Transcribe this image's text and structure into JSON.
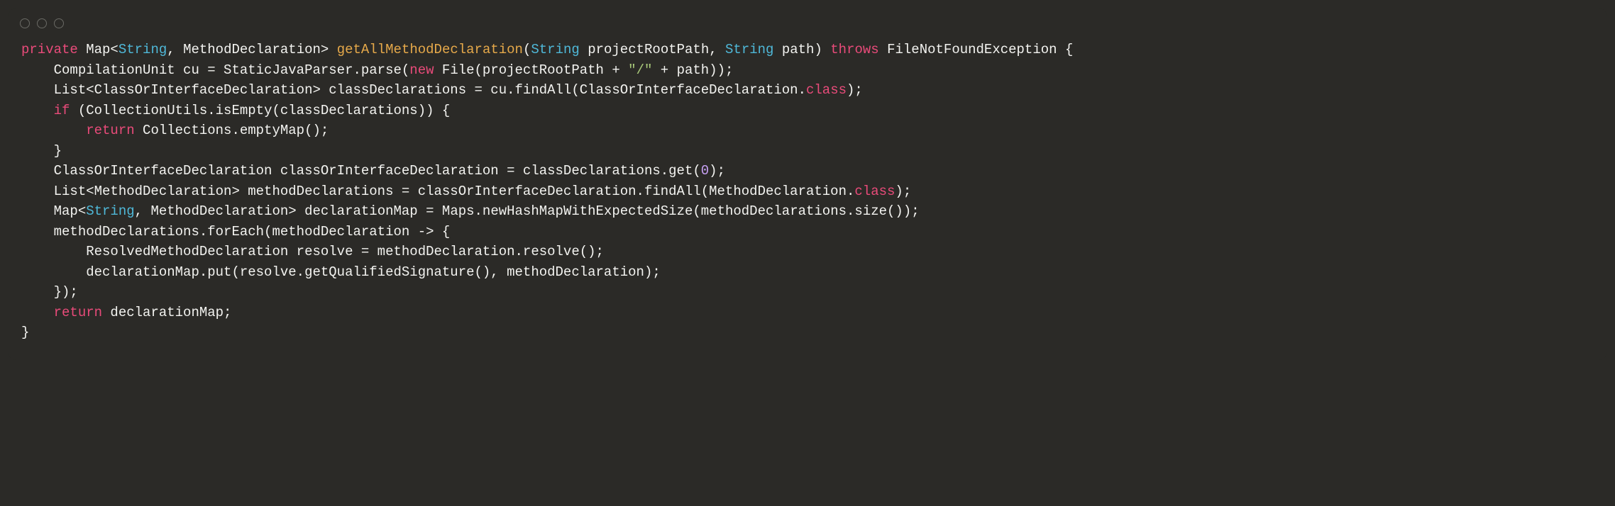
{
  "code": {
    "tokens": [
      {
        "t": "private",
        "c": "kw-private"
      },
      {
        "t": " Map<",
        "c": "plain"
      },
      {
        "t": "String",
        "c": "type-string"
      },
      {
        "t": ", MethodDeclaration> ",
        "c": "plain"
      },
      {
        "t": "getAllMethodDeclaration",
        "c": "method-name"
      },
      {
        "t": "(",
        "c": "plain"
      },
      {
        "t": "String",
        "c": "type-string"
      },
      {
        "t": " projectRootPath, ",
        "c": "plain"
      },
      {
        "t": "String",
        "c": "type-string"
      },
      {
        "t": " path) ",
        "c": "plain"
      },
      {
        "t": "throws",
        "c": "kw-throws"
      },
      {
        "t": " FileNotFoundException {\n",
        "c": "plain"
      },
      {
        "t": "    CompilationUnit cu = StaticJavaParser.parse(",
        "c": "plain"
      },
      {
        "t": "new",
        "c": "kw-new"
      },
      {
        "t": " File(projectRootPath + ",
        "c": "plain"
      },
      {
        "t": "\"/\"",
        "c": "string-lit"
      },
      {
        "t": " + path));\n",
        "c": "plain"
      },
      {
        "t": "    List<ClassOrInterfaceDeclaration> classDeclarations = cu.findAll(ClassOrInterfaceDeclaration.",
        "c": "plain"
      },
      {
        "t": "class",
        "c": "kw-class"
      },
      {
        "t": ");\n",
        "c": "plain"
      },
      {
        "t": "    ",
        "c": "plain"
      },
      {
        "t": "if",
        "c": "kw-if"
      },
      {
        "t": " (CollectionUtils.isEmpty(classDeclarations)) {\n",
        "c": "plain"
      },
      {
        "t": "        ",
        "c": "plain"
      },
      {
        "t": "return",
        "c": "kw-return"
      },
      {
        "t": " Collections.emptyMap();\n",
        "c": "plain"
      },
      {
        "t": "    }\n",
        "c": "plain"
      },
      {
        "t": "    ClassOrInterfaceDeclaration classOrInterfaceDeclaration = classDeclarations.get(",
        "c": "plain"
      },
      {
        "t": "0",
        "c": "number"
      },
      {
        "t": ");\n",
        "c": "plain"
      },
      {
        "t": "    List<MethodDeclaration> methodDeclarations = classOrInterfaceDeclaration.findAll(MethodDeclaration.",
        "c": "plain"
      },
      {
        "t": "class",
        "c": "kw-class"
      },
      {
        "t": ");\n",
        "c": "plain"
      },
      {
        "t": "    Map<",
        "c": "plain"
      },
      {
        "t": "String",
        "c": "type-string"
      },
      {
        "t": ", MethodDeclaration> declarationMap = Maps.newHashMapWithExpectedSize(methodDeclarations.size());\n",
        "c": "plain"
      },
      {
        "t": "    methodDeclarations.forEach(methodDeclaration -> {\n",
        "c": "plain"
      },
      {
        "t": "        ResolvedMethodDeclaration resolve = methodDeclaration.resolve();\n",
        "c": "plain"
      },
      {
        "t": "        declarationMap.put(resolve.getQualifiedSignature(), methodDeclaration);\n",
        "c": "plain"
      },
      {
        "t": "    });\n",
        "c": "plain"
      },
      {
        "t": "    ",
        "c": "plain"
      },
      {
        "t": "return",
        "c": "kw-return"
      },
      {
        "t": " declarationMap;\n",
        "c": "plain"
      },
      {
        "t": "}",
        "c": "plain"
      }
    ]
  }
}
